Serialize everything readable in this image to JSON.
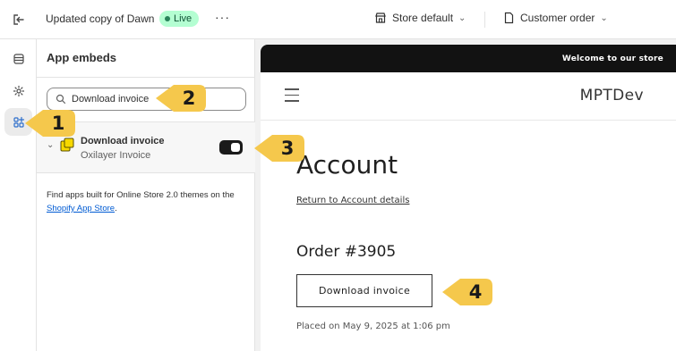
{
  "topbar": {
    "theme_title": "Updated copy of Dawn",
    "live_badge": "Live",
    "more": "···",
    "store_selector": "Store default",
    "template_selector": "Customer order"
  },
  "sidebar": {
    "heading": "App embeds",
    "search": {
      "value": "Download invoice",
      "placeholder": "Search"
    },
    "embed": {
      "name": "Download invoice",
      "app": "Oxilayer Invoice",
      "enabled": true
    },
    "find_apps_text": "Find apps built for Online Store 2.0 themes on the ",
    "find_apps_link": "Shopify App Store",
    "find_apps_end": "."
  },
  "preview": {
    "announcement": "Welcome to our store",
    "brand": "MPTDev",
    "page_title": "Account",
    "return_link": "Return to Account details",
    "order_number": "Order #3905",
    "download_button": "Download invoice",
    "placed_on": "Placed on May 9, 2025 at 1:06 pm"
  },
  "callouts": [
    "1",
    "2",
    "3",
    "4"
  ],
  "colors": {
    "callout": "#f5c84c",
    "live_badge": "#b4fed2",
    "toggle_on": "#1a1a1a",
    "link": "#005bd3",
    "announcement_bar": "#121212"
  },
  "icons": {
    "exit": "exit-icon",
    "store": "store-icon",
    "page": "page-icon",
    "sections": "sections-icon",
    "settings": "gear-icon",
    "app_embeds": "apps-icon",
    "search": "search-icon",
    "embed": "app-block-icon",
    "menu": "hamburger-icon"
  }
}
